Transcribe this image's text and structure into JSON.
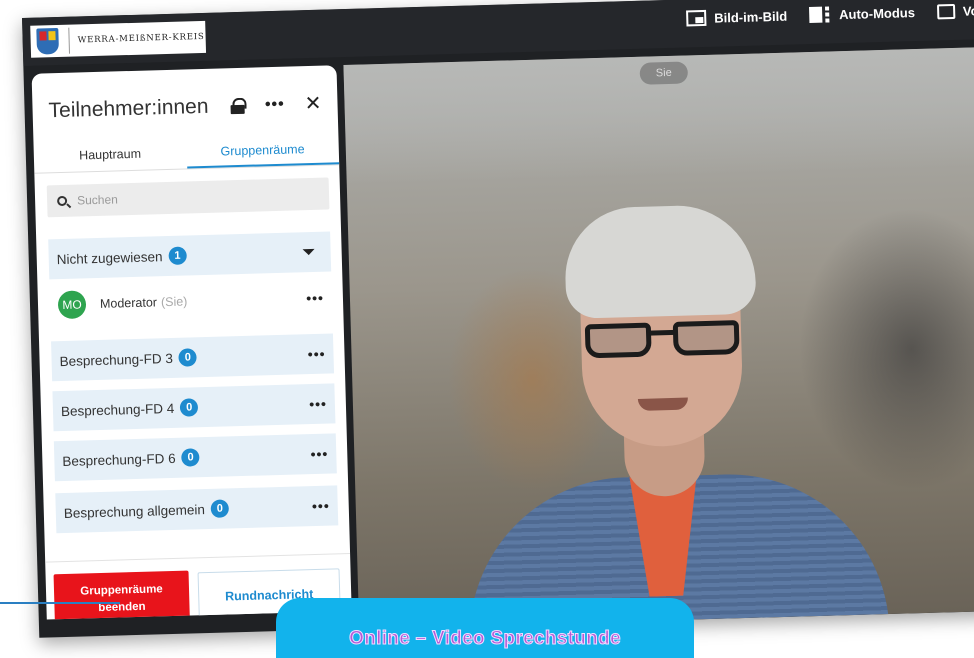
{
  "app": {
    "logo_text": "WERRA-MEIßNER-KREIS"
  },
  "topbar": {
    "actions": [
      {
        "label": "Bild-im-Bild",
        "icon": "picture-in-picture-icon"
      },
      {
        "label": "Auto-Modus",
        "icon": "auto-layout-icon"
      },
      {
        "label": "Vol",
        "icon": "fullscreen-icon"
      }
    ]
  },
  "panel": {
    "title": "Teilnehmer:innen",
    "tabs": [
      {
        "label": "Hauptraum",
        "active": false
      },
      {
        "label": "Gruppenräume",
        "active": true
      }
    ],
    "search_placeholder": "Suchen",
    "unassigned": {
      "label": "Nicht zugewiesen",
      "count": "1"
    },
    "participant": {
      "initials": "MO",
      "name": "Moderator",
      "suffix": "(Sie)"
    },
    "rooms": [
      {
        "label": "Besprechung-FD 3",
        "count": "0"
      },
      {
        "label": "Besprechung-FD 4",
        "count": "0"
      },
      {
        "label": "Besprechung-FD 6",
        "count": "0"
      },
      {
        "label": "Besprechung allgemein",
        "count": "0"
      }
    ],
    "footer": {
      "end_button_label": "Gruppenräume beenden",
      "broadcast_button_label": "Rundnachricht"
    }
  },
  "video": {
    "self_tag": "Sie"
  },
  "banner": {
    "text": "Online – Video Sprechstunde"
  },
  "colors": {
    "accent": "#1e8bcf",
    "danger": "#e8141b",
    "avatar": "#2ea44f",
    "banner": "#12b3ec"
  }
}
